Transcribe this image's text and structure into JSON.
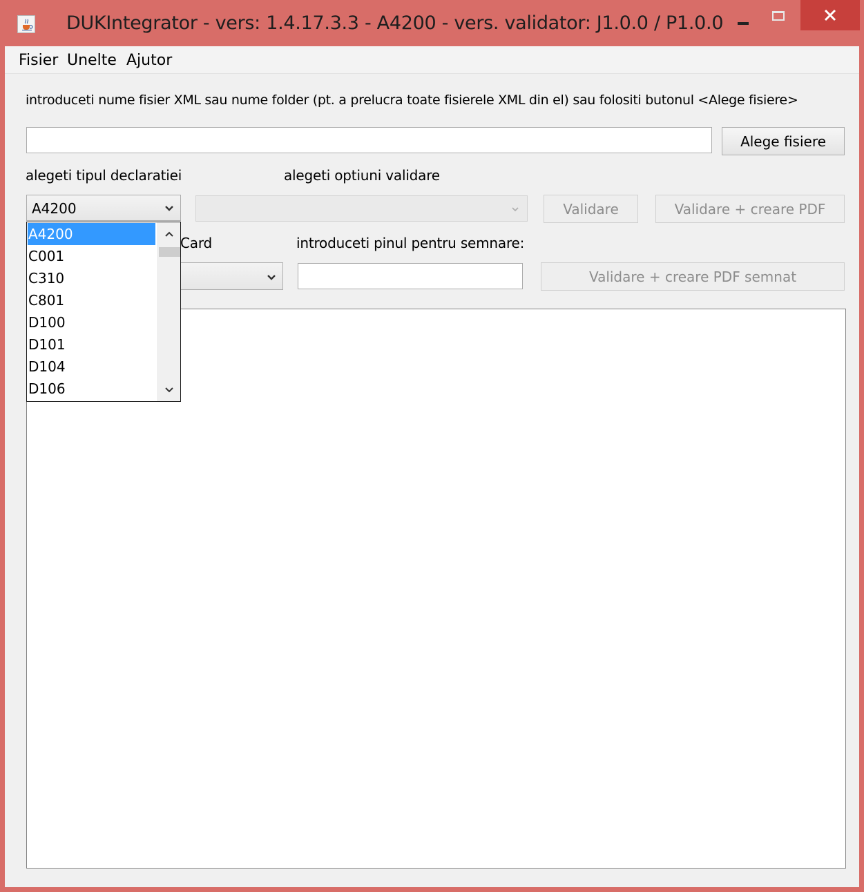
{
  "window": {
    "title": "DUKIntegrator - vers: 1.4.17.3.3 - A4200 - vers. validator: J1.0.0 / P1.0.0",
    "accent_color": "#d86d68",
    "close_color": "#c7403c",
    "icons": {
      "app": "java-cup-icon",
      "minimize": "minimize-icon",
      "maximize": "maximize-icon",
      "close": "close-icon"
    }
  },
  "menubar": {
    "items": [
      "Fisier",
      "Unelte",
      "Ajutor"
    ]
  },
  "form": {
    "instruction": "introduceti nume fisier XML sau nume folder (pt. a prelucra toate fisierele XML din el) sau folositi butonul <Alege fisiere>",
    "path_value": "",
    "choose_files_label": "Alege fisiere",
    "declaration_type_label": "alegeti tipul declaratiei",
    "validation_options_label": "alegeti optiuni validare",
    "declaration_type_selected": "A4200",
    "validation_option_selected": "",
    "validate_label": "Validare",
    "validate_pdf_label": "Validare + creare PDF",
    "card_label": "Card",
    "pin_label": "introduceti pinul pentru semnare:",
    "pin_value": "",
    "validate_signed_pdf_label": "Validare + creare PDF semnat"
  },
  "dropdown": {
    "options": [
      "A4200",
      "C001",
      "C310",
      "C801",
      "D100",
      "D101",
      "D104",
      "D106"
    ],
    "selected_index": 0,
    "selection_color": "#3399ff"
  },
  "output": {
    "text": ""
  }
}
